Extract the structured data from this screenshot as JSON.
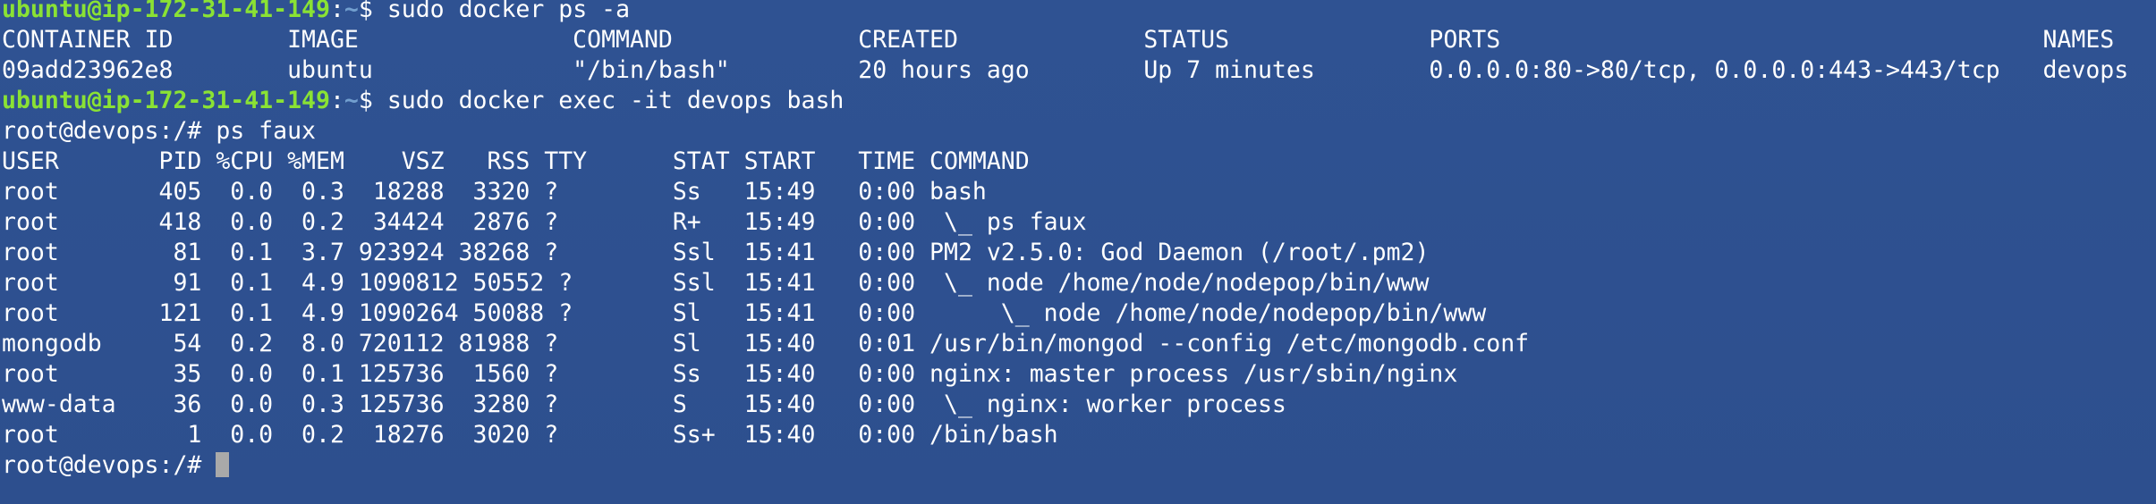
{
  "colors": {
    "background": "#2e5190",
    "foreground": "#ffffff",
    "prompt_user": "#8ae234",
    "prompt_path": "#729fcf",
    "cursor": "#a9a9a9"
  },
  "terminal": {
    "lines": [
      {
        "kind": "prompt",
        "user": "ubuntu@ip-172-31-41-149",
        "sep": ":",
        "path": "~",
        "symbol": "$ ",
        "command": "sudo docker ps -a"
      },
      {
        "kind": "output",
        "text": "CONTAINER ID        IMAGE               COMMAND             CREATED             STATUS              PORTS                                      NAMES"
      },
      {
        "kind": "output",
        "text": "09add23962e8        ubuntu              \"/bin/bash\"         20 hours ago        Up 7 minutes        0.0.0.0:80->80/tcp, 0.0.0.0:443->443/tcp   devops"
      },
      {
        "kind": "prompt",
        "user": "ubuntu@ip-172-31-41-149",
        "sep": ":",
        "path": "~",
        "symbol": "$ ",
        "command": "sudo docker exec -it devops bash"
      },
      {
        "kind": "output",
        "text": "root@devops:/# ps faux"
      },
      {
        "kind": "output",
        "text": "USER       PID %CPU %MEM    VSZ   RSS TTY      STAT START   TIME COMMAND"
      },
      {
        "kind": "output",
        "text": "root       405  0.0  0.3  18288  3320 ?        Ss   15:49   0:00 bash"
      },
      {
        "kind": "output",
        "text": "root       418  0.0  0.2  34424  2876 ?        R+   15:49   0:00  \\_ ps faux"
      },
      {
        "kind": "output",
        "text": "root        81  0.1  3.7 923924 38268 ?        Ssl  15:41   0:00 PM2 v2.5.0: God Daemon (/root/.pm2)"
      },
      {
        "kind": "output",
        "text": "root        91  0.1  4.9 1090812 50552 ?       Ssl  15:41   0:00  \\_ node /home/node/nodepop/bin/www"
      },
      {
        "kind": "output",
        "text": "root       121  0.1  4.9 1090264 50088 ?       Sl   15:41   0:00      \\_ node /home/node/nodepop/bin/www"
      },
      {
        "kind": "output",
        "text": "mongodb     54  0.2  8.0 720112 81988 ?        Sl   15:40   0:01 /usr/bin/mongod --config /etc/mongodb.conf"
      },
      {
        "kind": "output",
        "text": "root        35  0.0  0.1 125736  1560 ?        Ss   15:40   0:00 nginx: master process /usr/sbin/nginx"
      },
      {
        "kind": "output",
        "text": "www-data    36  0.0  0.3 125736  3280 ?        S    15:40   0:00  \\_ nginx: worker process"
      },
      {
        "kind": "output",
        "text": "root         1  0.0  0.2  18276  3020 ?        Ss+  15:40   0:00 /bin/bash"
      },
      {
        "kind": "input",
        "text": "root@devops:/# "
      }
    ]
  }
}
